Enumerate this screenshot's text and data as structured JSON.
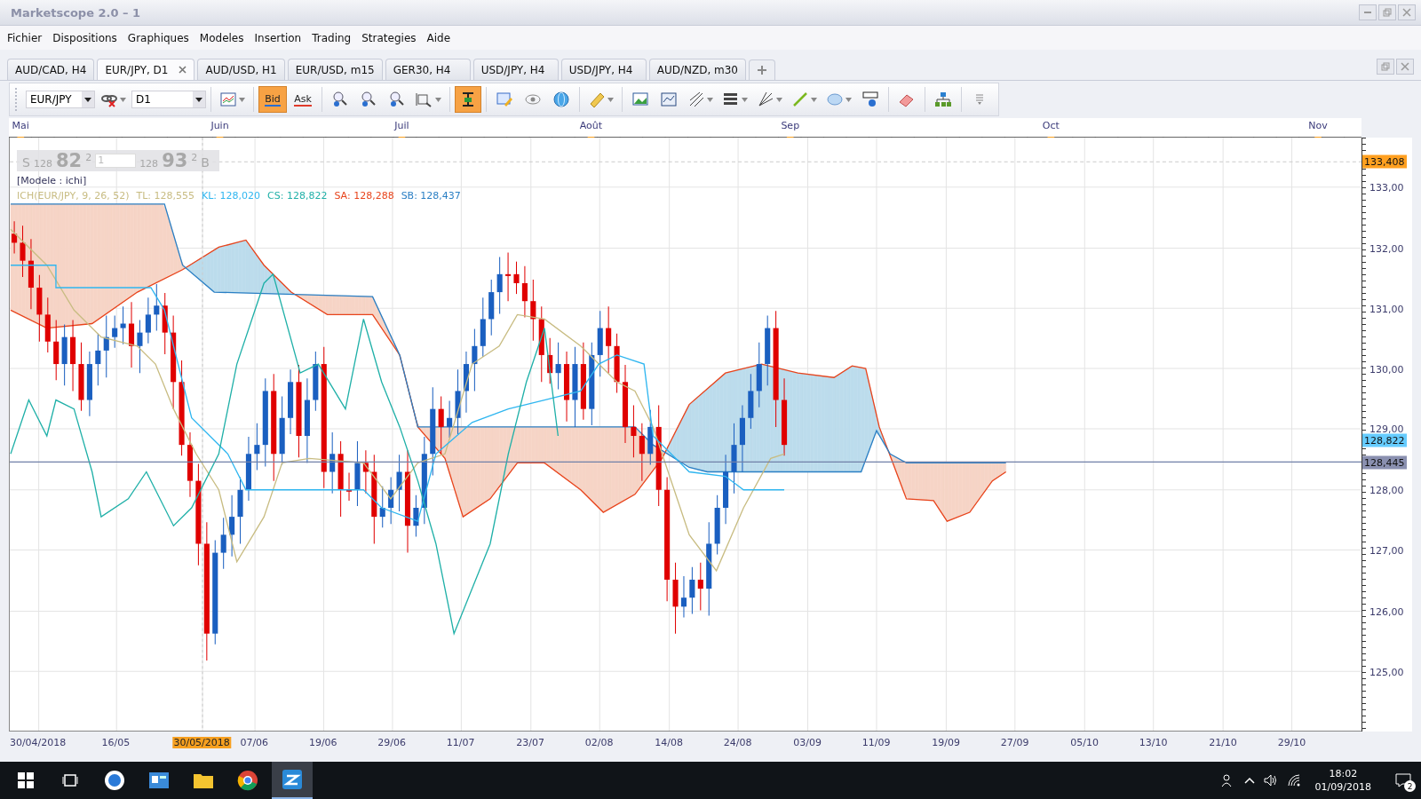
{
  "window": {
    "title": "Marketscope 2.0 – 1"
  },
  "menu": [
    "Fichier",
    "Dispositions",
    "Graphiques",
    "Modeles",
    "Insertion",
    "Trading",
    "Strategies",
    "Aide"
  ],
  "tabs": [
    {
      "label": "AUD/CAD, H4",
      "selected": false
    },
    {
      "label": "EUR/JPY, D1",
      "selected": true
    },
    {
      "label": "AUD/USD, H1",
      "selected": false
    },
    {
      "label": "EUR/USD, m15",
      "selected": false
    },
    {
      "label": "GER30, H4",
      "selected": false
    },
    {
      "label": "USD/JPY, H4",
      "selected": false
    },
    {
      "label": "USD/JPY, H4",
      "selected": false
    },
    {
      "label": "AUD/NZD, m30",
      "selected": false
    }
  ],
  "toolbar": {
    "symbol": "EUR/JPY",
    "timeframe": "D1",
    "price_side": [
      {
        "label": "Bid",
        "selected": true
      },
      {
        "label": "Ask",
        "selected": false
      }
    ],
    "tools": [
      {
        "selected": false
      },
      {
        "selected": false
      },
      {
        "selected": false
      },
      {
        "selected": false
      },
      {
        "selected": true
      },
      {
        "selected": false
      },
      {
        "selected": false
      },
      {
        "selected": false
      },
      {
        "selected": false
      },
      {
        "selected": false
      },
      {
        "selected": false
      },
      {
        "selected": false
      },
      {
        "selected": false
      },
      {
        "selected": false
      },
      {
        "selected": false
      },
      {
        "selected": false
      },
      {
        "selected": false
      },
      {
        "selected": false
      },
      {
        "selected": false
      }
    ]
  },
  "chart": {
    "months": [
      {
        "label": "Mai"
      },
      {
        "label": "Juin"
      },
      {
        "label": "Juil"
      },
      {
        "label": "Août"
      },
      {
        "label": "Sep"
      },
      {
        "label": "Oct"
      },
      {
        "label": "Nov"
      }
    ],
    "price_panel": {
      "sell": {
        "label": "S",
        "big": "128",
        "pips": "82",
        "fraction": "2"
      },
      "amount": "1",
      "buy": {
        "label": "B",
        "big": "128",
        "pips": "93",
        "fraction": "2"
      }
    },
    "model": "[Modele : ichi]",
    "legend": [
      {
        "text": "ICH(EUR/JPY, 9, 26, 52)",
        "color": "#c8bc82"
      },
      {
        "text": "TL: 128,555",
        "color": "#c8bc82"
      },
      {
        "text": "KL: 128,020",
        "color": "#2fb6f0"
      },
      {
        "text": "CS: 128,822",
        "color": "#20b0a8"
      },
      {
        "text": "SA: 128,288",
        "color": "#e8441c"
      },
      {
        "text": "SB: 128,437",
        "color": "#2a7fc4"
      }
    ],
    "price_labels": [
      "133,00",
      "132,00",
      "131,00",
      "130,00",
      "129,00",
      "128,00",
      "127,00",
      "126,00",
      "125,00"
    ],
    "price_badges": [
      {
        "text": "133,408",
        "color": "#ffa020"
      },
      {
        "text": "128,822",
        "color": "#66ccff"
      },
      {
        "text": "128,445",
        "color": "#8a90b0"
      }
    ],
    "dates": [
      {
        "label": "30/04/2018",
        "selected": false
      },
      {
        "label": "16/05",
        "selected": false
      },
      {
        "label": "30/05/2018",
        "selected": true
      },
      {
        "label": "07/06",
        "selected": false
      },
      {
        "label": "19/06",
        "selected": false
      },
      {
        "label": "29/06",
        "selected": false
      },
      {
        "label": "11/07",
        "selected": false
      },
      {
        "label": "23/07",
        "selected": false
      },
      {
        "label": "02/08",
        "selected": false
      },
      {
        "label": "14/08",
        "selected": false
      },
      {
        "label": "24/08",
        "selected": false
      },
      {
        "label": "03/09",
        "selected": false
      },
      {
        "label": "11/09",
        "selected": false
      },
      {
        "label": "19/09",
        "selected": false
      },
      {
        "label": "27/09",
        "selected": false
      },
      {
        "label": "05/10",
        "selected": false
      },
      {
        "label": "13/10",
        "selected": false
      },
      {
        "label": "21/10",
        "selected": false
      },
      {
        "label": "29/10",
        "selected": false
      }
    ]
  },
  "taskbar": {
    "time": "18:02",
    "date": "01/09/2018",
    "notifications": "2"
  }
}
